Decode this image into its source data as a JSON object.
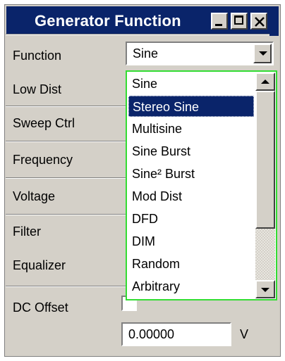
{
  "window": {
    "title": "Generator Function",
    "controls": [
      "minimize-icon",
      "maximize-icon",
      "close-icon"
    ]
  },
  "fields": {
    "function_label": "Function",
    "function_value": "Sine",
    "low_dist_label": "Low Dist",
    "sweep_ctrl_label": "Sweep Ctrl",
    "frequency_label": "Frequency",
    "voltage_label": "Voltage",
    "filter_label": "Filter",
    "equalizer_label": "Equalizer",
    "dc_offset_label": "DC Offset",
    "dc_offset_value": "0.00000",
    "dc_offset_unit": "V"
  },
  "dropdown": {
    "options": [
      "Sine",
      "Stereo Sine",
      "Multisine",
      "Sine Burst",
      "Sine² Burst",
      "Mod Dist",
      "DFD",
      "DIM",
      "Random",
      "Arbitrary"
    ],
    "highlighted": "Stereo Sine"
  },
  "colors": {
    "highlight": "#0a246a",
    "dropdown_border": "#33dd33",
    "face": "#d4d0c8"
  }
}
